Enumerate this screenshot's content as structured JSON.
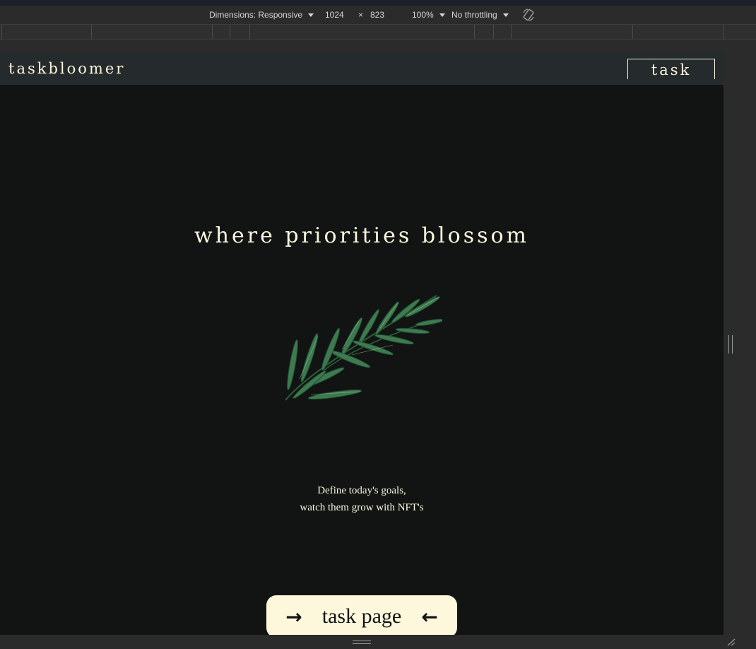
{
  "devtools": {
    "dimensions_label": "Dimensions: Responsive",
    "width_value": "1024",
    "times": "×",
    "height_value": "823",
    "zoom": "100%",
    "throttling": "No throttling"
  },
  "site": {
    "brand": "taskbloomer",
    "nav_link": "task page",
    "hero_title": "where priorities blossom",
    "tagline_line1": "Define today's goals,",
    "tagline_line2": "watch them grow with NFT's",
    "cta_label": "task page",
    "cta_arrow_right": "→",
    "cta_arrow_left": "←"
  },
  "colors": {
    "background": "#111413",
    "nav_bg": "#252a2c",
    "cream": "#fbf6dd",
    "leaf": "#3e7a4f"
  },
  "icons": [
    "rotate-icon",
    "plant-illustration",
    "arrow-right-icon",
    "arrow-left-icon",
    "resize-handle-icon"
  ]
}
